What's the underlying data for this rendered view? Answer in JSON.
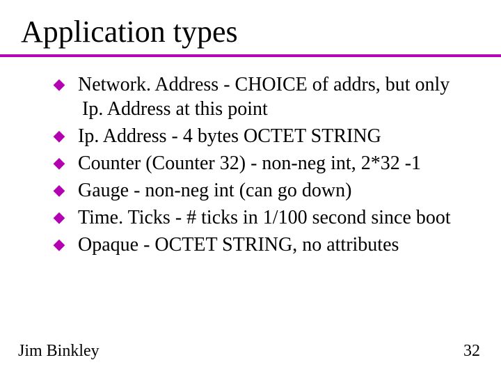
{
  "title": "Application types",
  "bullets": [
    {
      "text": "Network. Address - CHOICE of addrs, but only Ip. Address at this point"
    },
    {
      "text": "Ip. Address - 4 bytes OCTET STRING"
    },
    {
      "text": "Counter (Counter 32) - non-neg int, 2*32 -1"
    },
    {
      "text": "Gauge - non-neg int (can go down)"
    },
    {
      "text": "Time. Ticks - # ticks in 1/100 second since boot"
    },
    {
      "text": "Opaque - OCTET STRING, no attributes"
    }
  ],
  "footer": {
    "author": "Jim Binkley",
    "page": "32"
  },
  "colors": {
    "accent": "#b300b3"
  }
}
